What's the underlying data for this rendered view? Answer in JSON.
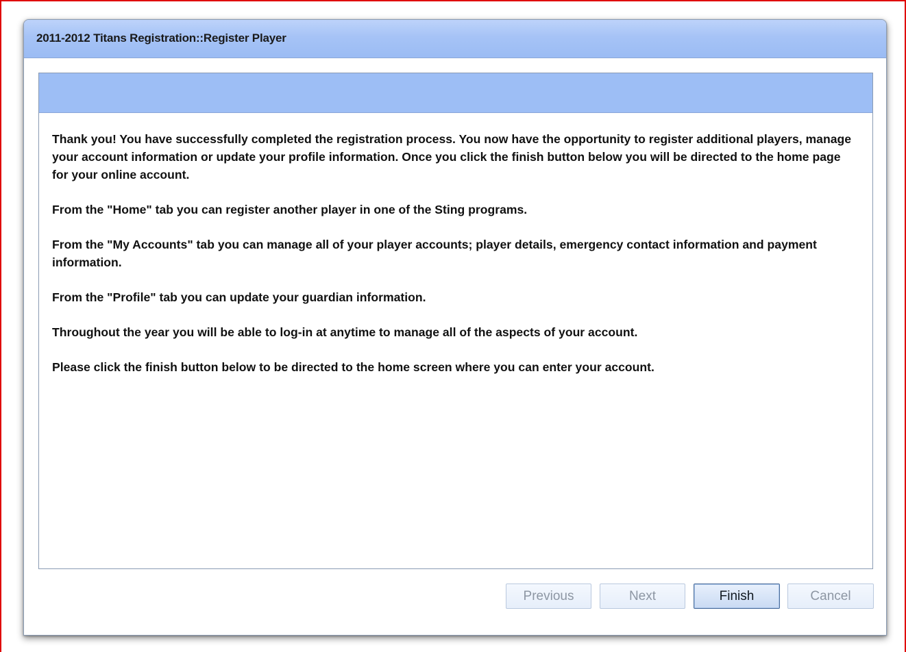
{
  "window": {
    "title": "2011-2012 Titans Registration::Register Player"
  },
  "message": {
    "paragraphs": [
      "Thank you! You have successfully completed the registration process. You now have the opportunity to register additional players, manage your account information or update your profile information. Once you click the finish button below you will be directed to the home page for your online account.",
      "From the \"Home\" tab you can register another player in one of the Sting programs.",
      "From the \"My Accounts\" tab you can manage all of your player accounts; player details, emergency contact information and payment information.",
      "From the \"Profile\" tab you can update your guardian information.",
      "Throughout the year you will be able to log-in at anytime to manage all of the aspects of your account.",
      "Please click the finish button below to be directed to the home screen where you can enter your account."
    ]
  },
  "buttons": {
    "previous": "Previous",
    "next": "Next",
    "finish": "Finish",
    "cancel": "Cancel"
  },
  "colors": {
    "frame_border": "#e00000",
    "titlebar": "#a6c3f6",
    "panel_header": "#9dbef5"
  }
}
